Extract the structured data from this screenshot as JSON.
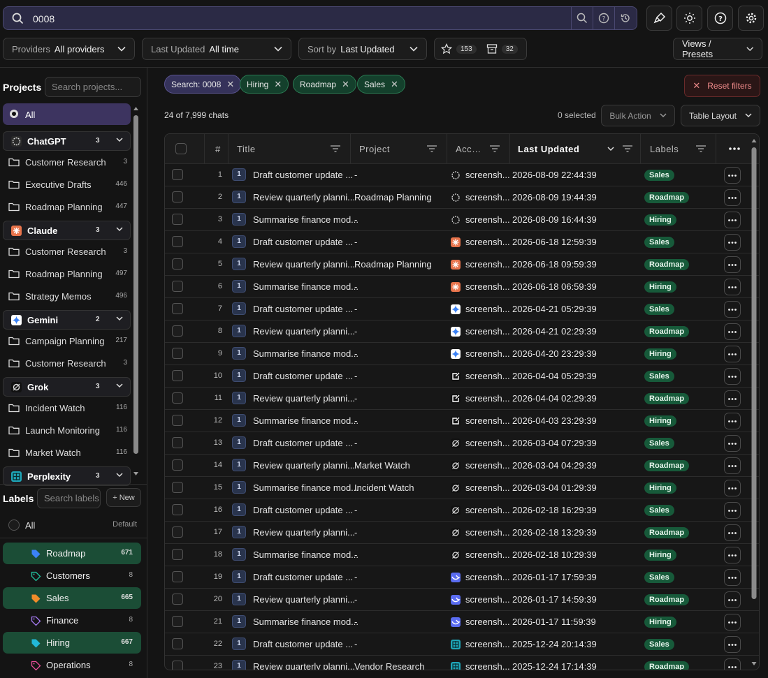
{
  "search": {
    "value": "0008"
  },
  "filters": {
    "providers_label": "Providers",
    "providers_value": "All providers",
    "updated_label": "Last Updated",
    "updated_value": "All time",
    "sort_label": "Sort by",
    "sort_value": "Last Updated",
    "starred_count": "153",
    "archived_count": "32",
    "views_label": "Views / Presets"
  },
  "sidebar": {
    "projects_title": "Projects",
    "projects_search_placeholder": "Search projects...",
    "all_label": "All",
    "providers": [
      {
        "name": "ChatGPT",
        "count": "3",
        "color": "#2a2a2a",
        "projects": [
          {
            "name": "Customer Research",
            "count": "3"
          },
          {
            "name": "Executive Drafts",
            "count": "446"
          },
          {
            "name": "Roadmap Planning",
            "count": "447"
          }
        ]
      },
      {
        "name": "Claude",
        "count": "3",
        "color": "#e8744c",
        "projects": [
          {
            "name": "Customer Research",
            "count": "3"
          },
          {
            "name": "Roadmap Planning",
            "count": "497"
          },
          {
            "name": "Strategy Memos",
            "count": "496"
          }
        ]
      },
      {
        "name": "Gemini",
        "count": "2",
        "color": "#ffffff",
        "projects": [
          {
            "name": "Campaign Planning",
            "count": "217"
          },
          {
            "name": "Customer Research",
            "count": "3"
          }
        ]
      },
      {
        "name": "Grok",
        "count": "3",
        "color": "#111111",
        "projects": [
          {
            "name": "Incident Watch",
            "count": "116"
          },
          {
            "name": "Launch Monitoring",
            "count": "116"
          },
          {
            "name": "Market Watch",
            "count": "116"
          }
        ]
      },
      {
        "name": "Perplexity",
        "count": "3",
        "color": "#1fa6b8",
        "projects": []
      }
    ],
    "labels_title": "Labels",
    "labels_search_placeholder": "Search labels",
    "new_label": "+ New",
    "labels_all": "All",
    "labels_default": "Default",
    "labels": [
      {
        "name": "Roadmap",
        "count": "671",
        "color": "#3b82f6",
        "selected": true
      },
      {
        "name": "Customers",
        "count": "8",
        "color": "#22c5a0",
        "selected": false
      },
      {
        "name": "Sales",
        "count": "665",
        "color": "#f08c2a",
        "selected": true
      },
      {
        "name": "Finance",
        "count": "8",
        "color": "#a77bf3",
        "selected": false
      },
      {
        "name": "Hiring",
        "count": "667",
        "color": "#22b8d8",
        "selected": true
      },
      {
        "name": "Operations",
        "count": "8",
        "color": "#ec4f9b",
        "selected": false
      }
    ]
  },
  "chips": [
    {
      "label": "Search: 0008",
      "kind": "search"
    },
    {
      "label": "Hiring",
      "kind": "label"
    },
    {
      "label": "Roadmap",
      "kind": "label"
    },
    {
      "label": "Sales",
      "kind": "label"
    }
  ],
  "reset_label": "Reset filters",
  "summary": "24 of 7,999 chats",
  "selected_text": "0 selected",
  "bulk_action": "Bulk Action",
  "table_layout": "Table Layout",
  "columns": {
    "num": "#",
    "title": "Title",
    "project": "Project",
    "account": "Acc…",
    "updated": "Last Updated",
    "labels": "Labels"
  },
  "rows": [
    {
      "n": "1",
      "badge": "1",
      "title": "Draft customer update ...",
      "project": "-",
      "provider": "chatgpt",
      "account": "screensh...",
      "updated": "2026-08-09 22:44:39",
      "label": "Sales"
    },
    {
      "n": "2",
      "badge": "1",
      "title": "Review quarterly planni...",
      "project": "Roadmap Planning",
      "provider": "chatgpt",
      "account": "screensh...",
      "updated": "2026-08-09 19:44:39",
      "label": "Roadmap"
    },
    {
      "n": "3",
      "badge": "1",
      "title": "Summarise finance mod...",
      "project": "-",
      "provider": "chatgpt",
      "account": "screensh...",
      "updated": "2026-08-09 16:44:39",
      "label": "Hiring"
    },
    {
      "n": "4",
      "badge": "1",
      "title": "Draft customer update ...",
      "project": "-",
      "provider": "claude",
      "account": "screensh...",
      "updated": "2026-06-18 12:59:39",
      "label": "Sales"
    },
    {
      "n": "5",
      "badge": "1",
      "title": "Review quarterly planni...",
      "project": "Roadmap Planning",
      "provider": "claude",
      "account": "screensh...",
      "updated": "2026-06-18 09:59:39",
      "label": "Roadmap"
    },
    {
      "n": "6",
      "badge": "1",
      "title": "Summarise finance mod...",
      "project": "-",
      "provider": "claude",
      "account": "screensh...",
      "updated": "2026-06-18 06:59:39",
      "label": "Hiring"
    },
    {
      "n": "7",
      "badge": "1",
      "title": "Draft customer update ...",
      "project": "-",
      "provider": "gemini",
      "account": "screensh...",
      "updated": "2026-04-21 05:29:39",
      "label": "Sales"
    },
    {
      "n": "8",
      "badge": "1",
      "title": "Review quarterly planni...",
      "project": "-",
      "provider": "gemini",
      "account": "screensh...",
      "updated": "2026-04-21 02:29:39",
      "label": "Roadmap"
    },
    {
      "n": "9",
      "badge": "1",
      "title": "Summarise finance mod...",
      "project": "-",
      "provider": "gemini",
      "account": "screensh...",
      "updated": "2026-04-20 23:29:39",
      "label": "Hiring"
    },
    {
      "n": "10",
      "badge": "1",
      "title": "Draft customer update ...",
      "project": "-",
      "provider": "copilot",
      "account": "screensh...",
      "updated": "2026-04-04 05:29:39",
      "label": "Sales"
    },
    {
      "n": "11",
      "badge": "1",
      "title": "Review quarterly planni...",
      "project": "-",
      "provider": "copilot",
      "account": "screensh...",
      "updated": "2026-04-04 02:29:39",
      "label": "Roadmap"
    },
    {
      "n": "12",
      "badge": "1",
      "title": "Summarise finance mod...",
      "project": "-",
      "provider": "copilot",
      "account": "screensh...",
      "updated": "2026-04-03 23:29:39",
      "label": "Hiring"
    },
    {
      "n": "13",
      "badge": "1",
      "title": "Draft customer update ...",
      "project": "-",
      "provider": "grok",
      "account": "screensh...",
      "updated": "2026-03-04 07:29:39",
      "label": "Sales"
    },
    {
      "n": "14",
      "badge": "1",
      "title": "Review quarterly planni...",
      "project": "Market Watch",
      "provider": "grok",
      "account": "screensh...",
      "updated": "2026-03-04 04:29:39",
      "label": "Roadmap"
    },
    {
      "n": "15",
      "badge": "1",
      "title": "Summarise finance mod...",
      "project": "Incident Watch",
      "provider": "grok",
      "account": "screensh...",
      "updated": "2026-03-04 01:29:39",
      "label": "Hiring"
    },
    {
      "n": "16",
      "badge": "1",
      "title": "Draft customer update ...",
      "project": "-",
      "provider": "grok",
      "account": "screensh...",
      "updated": "2026-02-18 16:29:39",
      "label": "Sales"
    },
    {
      "n": "17",
      "badge": "1",
      "title": "Review quarterly planni...",
      "project": "-",
      "provider": "grok",
      "account": "screensh...",
      "updated": "2026-02-18 13:29:39",
      "label": "Roadmap"
    },
    {
      "n": "18",
      "badge": "1",
      "title": "Summarise finance mod...",
      "project": "-",
      "provider": "grok",
      "account": "screensh...",
      "updated": "2026-02-18 10:29:39",
      "label": "Hiring"
    },
    {
      "n": "19",
      "badge": "1",
      "title": "Draft customer update ...",
      "project": "-",
      "provider": "deepseek",
      "account": "screensh...",
      "updated": "2026-01-17 17:59:39",
      "label": "Sales"
    },
    {
      "n": "20",
      "badge": "1",
      "title": "Review quarterly planni...",
      "project": "-",
      "provider": "deepseek",
      "account": "screensh...",
      "updated": "2026-01-17 14:59:39",
      "label": "Roadmap"
    },
    {
      "n": "21",
      "badge": "1",
      "title": "Summarise finance mod...",
      "project": "-",
      "provider": "deepseek",
      "account": "screensh...",
      "updated": "2026-01-17 11:59:39",
      "label": "Hiring"
    },
    {
      "n": "22",
      "badge": "1",
      "title": "Draft customer update ...",
      "project": "-",
      "provider": "perplexity",
      "account": "screensh...",
      "updated": "2025-12-24 20:14:39",
      "label": "Sales"
    },
    {
      "n": "23",
      "badge": "1",
      "title": "Review quarterly planni...",
      "project": "Vendor Research",
      "provider": "perplexity",
      "account": "screensh...",
      "updated": "2025-12-24 17:14:39",
      "label": "Roadmap"
    }
  ],
  "provider_colors": {
    "chatgpt": "#2a2a2a",
    "claude": "#e8744c",
    "gemini": "#ffffff",
    "copilot": "#111111",
    "grok": "#111111",
    "deepseek": "#5a6cf0",
    "perplexity": "#1fa6b8"
  }
}
